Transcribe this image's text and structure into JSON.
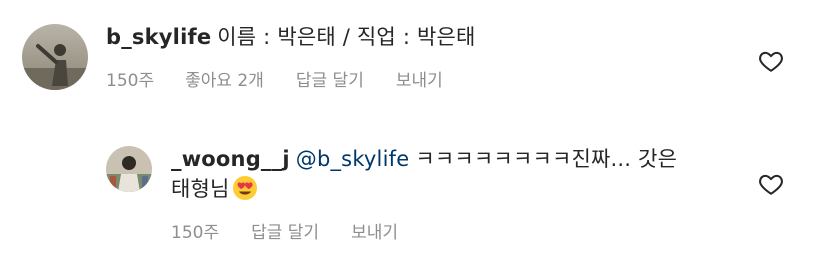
{
  "comments": [
    {
      "username": "b_skylife",
      "text": "이름 : 박은태 / 직업 : 박은태",
      "time": "150주",
      "likes": "좋아요 2개",
      "reply_label": "답글 달기",
      "send_label": "보내기"
    },
    {
      "username": "_woong__j",
      "mention": "@b_skylife",
      "text_line1": "ㅋㅋㅋㅋㅋㅋㅋㅋ진짜... 갓은",
      "text_line2": "태형님",
      "emoji": "heart-eyes-emoji",
      "time": "150주",
      "reply_label": "답글 달기",
      "send_label": "보내기"
    }
  ],
  "icons": {
    "like": "heart-outline-icon"
  },
  "colors": {
    "text": "#262626",
    "meta": "#8e8e8e",
    "mention": "#00376b"
  }
}
